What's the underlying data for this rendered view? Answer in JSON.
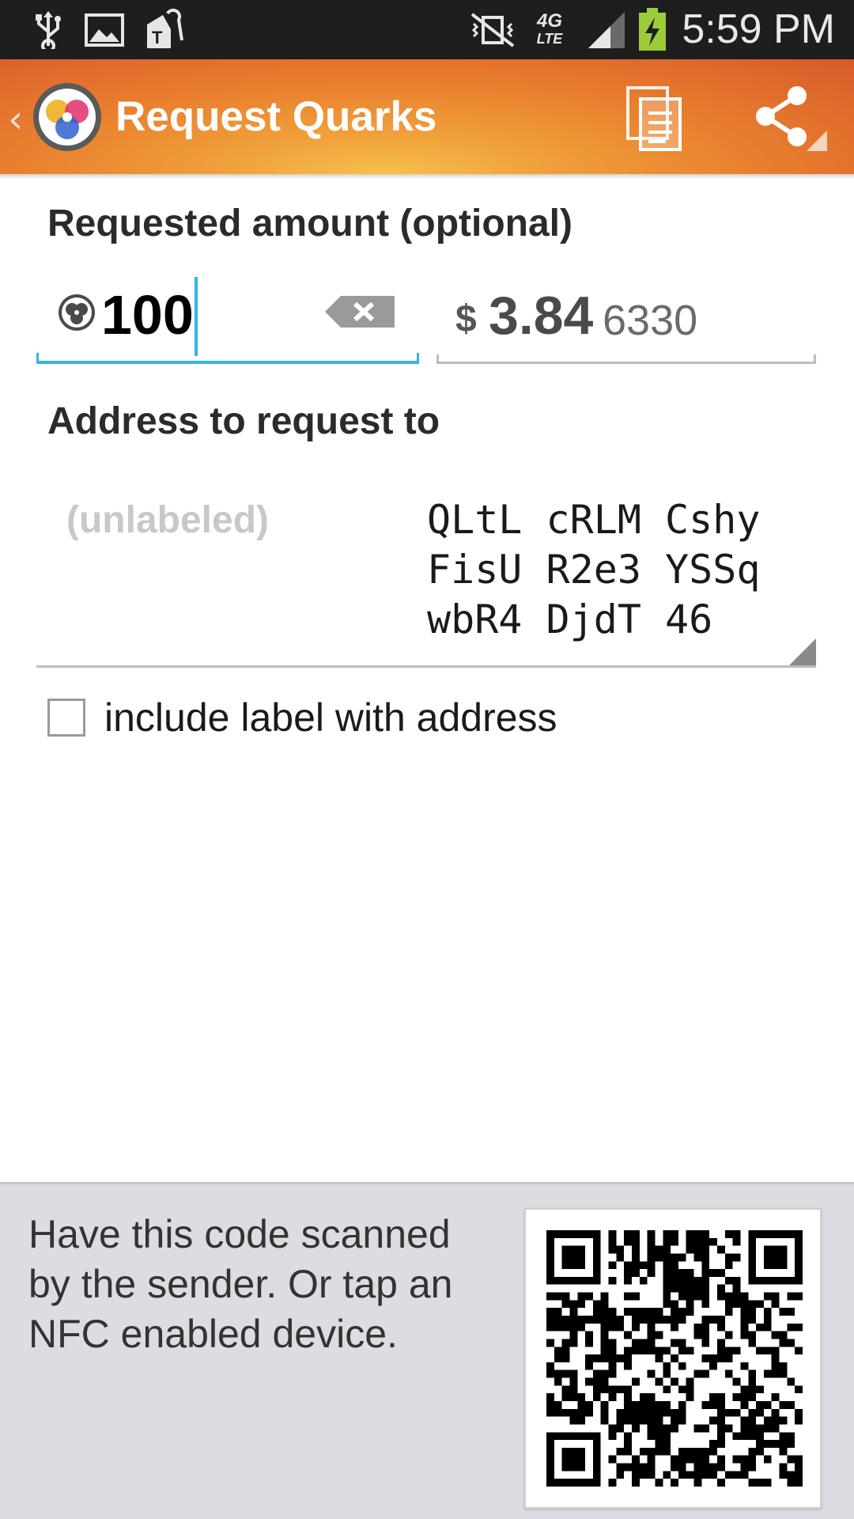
{
  "status_bar": {
    "time": "5:59 PM",
    "icons": [
      "usb-icon",
      "image-icon",
      "carrier-tag-icon",
      "mute-vibrate-icon",
      "4g-lte-icon",
      "signal-icon",
      "battery-charging-icon"
    ],
    "network_label_top": "4G",
    "network_label_bottom": "LTE"
  },
  "action_bar": {
    "title": "Request Quarks",
    "actions": [
      "copy-icon",
      "share-icon"
    ]
  },
  "amount": {
    "label": "Requested amount (optional)",
    "value": "100",
    "fiat_symbol": "$",
    "fiat_major": "3.84",
    "fiat_minor": "6330"
  },
  "address": {
    "label": "Address to request to",
    "address_label": "(unlabeled)",
    "lines": [
      "QLtL cRLM Cshy",
      "FisU R2e3 YSSq",
      "wbR4 DjdT 46"
    ]
  },
  "include_label": {
    "text": "include label with address",
    "checked": false
  },
  "bottom": {
    "instructions": "Have this code scanned by the sender. Or tap an NFC enabled device."
  },
  "colors": {
    "accent": "#33b5e5",
    "action_bar_top": "#e9802e",
    "bottom_panel": "#dcdde3"
  }
}
